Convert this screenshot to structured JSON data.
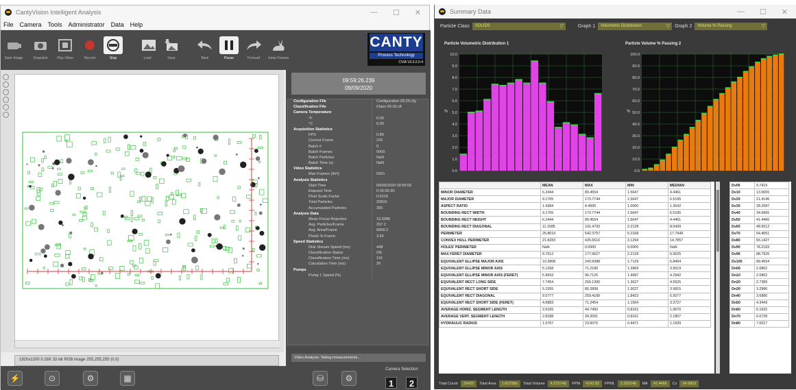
{
  "app": {
    "title": "CantyVision Intelligent Analysis",
    "menu": [
      "File",
      "Camera",
      "Tools",
      "Administrator",
      "Data",
      "Help"
    ],
    "window_buttons": [
      "—",
      "☐",
      "✕"
    ]
  },
  "toolbar": {
    "buttons": [
      {
        "label": "Save Image",
        "icon": "camera-icon"
      },
      {
        "label": "Snapshot",
        "icon": "snapshot-icon"
      },
      {
        "label": "Play Video",
        "icon": "film-icon"
      },
      {
        "label": "Record",
        "icon": "record-icon"
      },
      {
        "label": "Stop",
        "icon": "stop-icon"
      },
      {
        "label": "Load",
        "icon": "image-icon"
      },
      {
        "label": "Save",
        "icon": "save-image-icon"
      },
      {
        "label": "Back",
        "icon": "back-arrow-icon"
      },
      {
        "label": "Pause",
        "icon": "pause-icon"
      },
      {
        "label": "Forward",
        "icon": "forward-arrow-icon"
      },
      {
        "label": "Jump Frames",
        "icon": "rabbit-icon"
      }
    ],
    "logo": {
      "name": "CANTY",
      "subtitle": "Process Technology",
      "version": "CVIA V3.0.2.0.4"
    }
  },
  "image_status": "1920x1200 0.28X 32-bit RGB image 255,255,255  (0,0)",
  "clock": {
    "time": "09:59:26.239",
    "date": "09/09/2020"
  },
  "tree": [
    {
      "label": "Configuration File",
      "value": "Configuration 09.20.cfg",
      "header": true
    },
    {
      "label": "Classification File",
      "value": "Class 09.20.clf",
      "header": true
    },
    {
      "label": "Camera Temperature",
      "value": "",
      "header": true
    },
    {
      "label": "°F",
      "value": "0.00",
      "header": false
    },
    {
      "label": "°C",
      "value": "0.00",
      "header": false
    },
    {
      "label": "Acquisition Statistics",
      "value": "",
      "header": true
    },
    {
      "label": "FPS",
      "value": "0.89",
      "header": false
    },
    {
      "label": "Current Frame",
      "value": "242",
      "header": false
    },
    {
      "label": "Batch #",
      "value": "0",
      "header": false
    },
    {
      "label": "Batch Frames",
      "value": "5000",
      "header": false
    },
    {
      "label": "Batch Particles",
      "value": "NaN",
      "header": false
    },
    {
      "label": "Batch Time (s)",
      "value": "NaN",
      "header": false
    },
    {
      "label": "Video Statistics",
      "value": "",
      "header": true
    },
    {
      "label": "Max Frames (AVI)",
      "value": "5001",
      "header": false
    },
    {
      "label": "Analysis Statistics",
      "value": "",
      "header": true
    },
    {
      "label": "Start Time",
      "value": "09/09/2020 09:59:55",
      "header": false
    },
    {
      "label": "Elapsed Time",
      "value": "0  00:00:30",
      "header": false
    },
    {
      "label": "Pixel Scale Factor",
      "value": "0.5216",
      "header": false
    },
    {
      "label": "Total Particles",
      "value": "20816",
      "header": false
    },
    {
      "label": "Accumulated Particles",
      "value": "355",
      "header": false
    },
    {
      "label": "Analysis Data",
      "value": "",
      "header": true
    },
    {
      "label": "Mean Focus Rejection",
      "value": "15.5086",
      "header": false
    },
    {
      "label": "Avg. Particles/Frame",
      "value": "297.2",
      "header": false
    },
    {
      "label": "Avg. Area/Frame",
      "value": "6858.2",
      "header": false
    },
    {
      "label": "Pixels % Frame",
      "value": "3.65",
      "header": false
    },
    {
      "label": "Speed Statistics",
      "value": "",
      "header": true
    },
    {
      "label": "Disk Stream Speed (ms)",
      "value": "448",
      "header": false
    },
    {
      "label": "Classification Status",
      "value": "OK",
      "header": false
    },
    {
      "label": "Classification Time (ms)",
      "value": "191",
      "header": false
    },
    {
      "label": "Calculation Time (ms)",
      "value": "26",
      "header": false
    },
    {
      "label": "Pumps",
      "value": "",
      "header": true
    },
    {
      "label": "Pump 1 Speed (%)",
      "value": "",
      "header": false
    }
  ],
  "analysis_status": "Video Analysis: Taking measurements...",
  "bottom_tools": [
    "measure-icon",
    "zoom-particle-icon",
    "analysis-icon",
    "report-icon"
  ],
  "camera_selection": {
    "label": "Camera Selection",
    "cameras": [
      "1",
      "2"
    ]
  },
  "summary": {
    "title": "Summary Data",
    "particle_class_label": "Particle Class",
    "particle_class": "SOLIDS",
    "graph1_label": "Graph 1",
    "graph1": "Volumetric Distribution",
    "graph2_label": "Graph 2",
    "graph2": "Volume % Passing"
  },
  "colors": {
    "magenta": "#e044e6",
    "orange": "#e87a10",
    "chart_bg": "#0d0d0d",
    "accent_olive": "#6f6f3a"
  },
  "chart_data": [
    {
      "type": "bar",
      "title": "Particle Volumetric Distribution 1",
      "ylabel": "%",
      "ylim": [
        0,
        10
      ],
      "yticks": [
        "10.0",
        "9.0",
        "8.0",
        "7.0",
        "6.0",
        "5.0",
        "4.0",
        "3.0",
        "2.0",
        "1.0",
        "0.0"
      ],
      "values": [
        1.4,
        5.0,
        5.1,
        6.1,
        7.4,
        7.3,
        7.5,
        7.8,
        7.5,
        9.4,
        7.5,
        5.9,
        3.7,
        4.1,
        3.9,
        3.1,
        2.8,
        6.6
      ],
      "color": "#e044e6",
      "grid": true
    },
    {
      "type": "bar",
      "title": "Particle Volume % Passing 2",
      "ylabel": "%",
      "ylim": [
        0,
        100
      ],
      "yticks": [
        "100.0",
        "90.0",
        "80.0",
        "70.0",
        "60.0",
        "50.0",
        "40.0",
        "30.0",
        "20.0",
        "10.0",
        "0.0"
      ],
      "values": [
        1,
        2,
        5,
        9,
        14,
        20,
        26,
        31,
        37,
        43,
        49,
        55,
        61,
        66,
        71,
        76,
        80,
        85,
        89,
        93,
        96,
        98,
        99,
        100
      ],
      "color": "#e87a10",
      "grid": true
    }
  ],
  "stats_table": {
    "columns": [
      "",
      "MEAN",
      "MAX",
      "MIN",
      "MEDIAN"
    ],
    "rows": [
      [
        "MINOR DIAMETER",
        "6.2444",
        "89.4554",
        "1.5647",
        "4.4461"
      ],
      [
        "MAJOR DIAMETER",
        "9.1705",
        "173.7744",
        "1.5647",
        "6.5195"
      ],
      [
        "ASPECT RATIO",
        "1.4384",
        "4.4595",
        "1.0000",
        "1.3542"
      ],
      [
        "BOUNDING RECT WIDTH",
        "9.1705",
        "173.7744",
        "1.5647",
        "6.5195"
      ],
      [
        "BOUNDING RECT HEIGHT",
        "6.2444",
        "89.4554",
        "1.5647",
        "4.4461"
      ],
      [
        "BOUNDING RECT DIAGONAL",
        "11.1585",
        "191.4793",
        "2.2128",
        "8.0439"
      ],
      [
        "PERIMETER",
        "25.8019",
        "542.3757",
        "5.2108",
        "17.7949"
      ],
      [
        "CONVEX HULL PERIMETER",
        "21.8283",
        "425.6516",
        "3.1294",
        "14.7857"
      ],
      [
        "HOLES' PERIMETER",
        "NaN",
        "0.0000",
        "0.0000",
        "NaN"
      ],
      [
        "MAX FERET DIAMETER",
        "9.7012",
        "177.9627",
        "2.2128",
        "6.9625"
      ],
      [
        "EQUIVALENT ELLIPSE MAJOR AXIS",
        "10.2808",
        "243.6088",
        "1.7129",
        "6.8404"
      ],
      [
        "EQUIVALENT ELLIPSE MINOR AXIS",
        "5.1268",
        "71.2180",
        "1.3969",
        "3.9519"
      ],
      [
        "EQUIVALENT ELLIPSE MINOR AXIS (FERET)",
        "5.9693",
        "90.7125",
        "1.4087",
        "4.2942"
      ],
      [
        "EQUIVALENT RECT LONG SIDE",
        "7.7454",
        "259.1390",
        "1.3027",
        "4.5525"
      ],
      [
        "EQUIVALENT RECT SHORT SIDE",
        "5.1555",
        "80.2808",
        "1.3027",
        "3.9815"
      ],
      [
        "EQUIVALENT RECT DIAGONAL",
        "9.5777",
        "259.4189",
        "1.8423",
        "6.5077"
      ],
      [
        "EQUIVALENT RECT SHORT SIDE (FERET)",
        "4.6883",
        "71.2454",
        "1.1064",
        "3.3727"
      ],
      [
        "AVERAGE HORIZ. SEGMENT LENGTH",
        "2.6165",
        "44.7450",
        "0.8161",
        "1.9670"
      ],
      [
        "AVERAGE VERT. SEGMENT LENGTH",
        "2.8188",
        "34.2091",
        "0.8161",
        "2.1807"
      ],
      [
        "HYDRAULIC RADIUS",
        "1.5707",
        "23.6075",
        "0.4471",
        "1.1939"
      ]
    ]
  },
  "dv_table": [
    [
      "Dv06",
      "9.7419"
    ],
    [
      "Dv10",
      "13.5655"
    ],
    [
      "Dv20",
      "21.4146"
    ],
    [
      "Dv30",
      "28.2087"
    ],
    [
      "Dv40",
      "34.6855"
    ],
    [
      "Dv50",
      "41.4466"
    ],
    [
      "Dv60",
      "48.5612"
    ],
    [
      "Dv70",
      "54.4051"
    ],
    [
      "Dv80",
      "65.1427"
    ],
    [
      "Dv90",
      "78.2183"
    ],
    [
      "Dv96",
      "88.7926"
    ],
    [
      "Dv100",
      "89.4554"
    ],
    [
      "Dn06",
      "2.0862"
    ],
    [
      "Dn10",
      "2.0862"
    ],
    [
      "Dn20",
      "2.7389"
    ],
    [
      "Dn30",
      "3.2986"
    ],
    [
      "Dn40",
      "3.6880"
    ],
    [
      "Dn50",
      "4.3443"
    ],
    [
      "Dn60",
      "5.1632"
    ],
    [
      "Dn70",
      "6.0728"
    ],
    [
      "Dn80",
      "7.6017"
    ]
  ],
  "footer": [
    {
      "label": "Total Count",
      "value": "20425"
    },
    {
      "label": "Total Area",
      "value": "1.60708E"
    },
    {
      "label": "Total Volume",
      "value": "4.27574E"
    },
    {
      "label": "PPM",
      "value": "4142.82"
    },
    {
      "label": "PPML",
      "value": "2.35014E"
    },
    {
      "label": "MA",
      "value": "41.4466"
    },
    {
      "label": "Cv",
      "value": "64.6803"
    }
  ]
}
